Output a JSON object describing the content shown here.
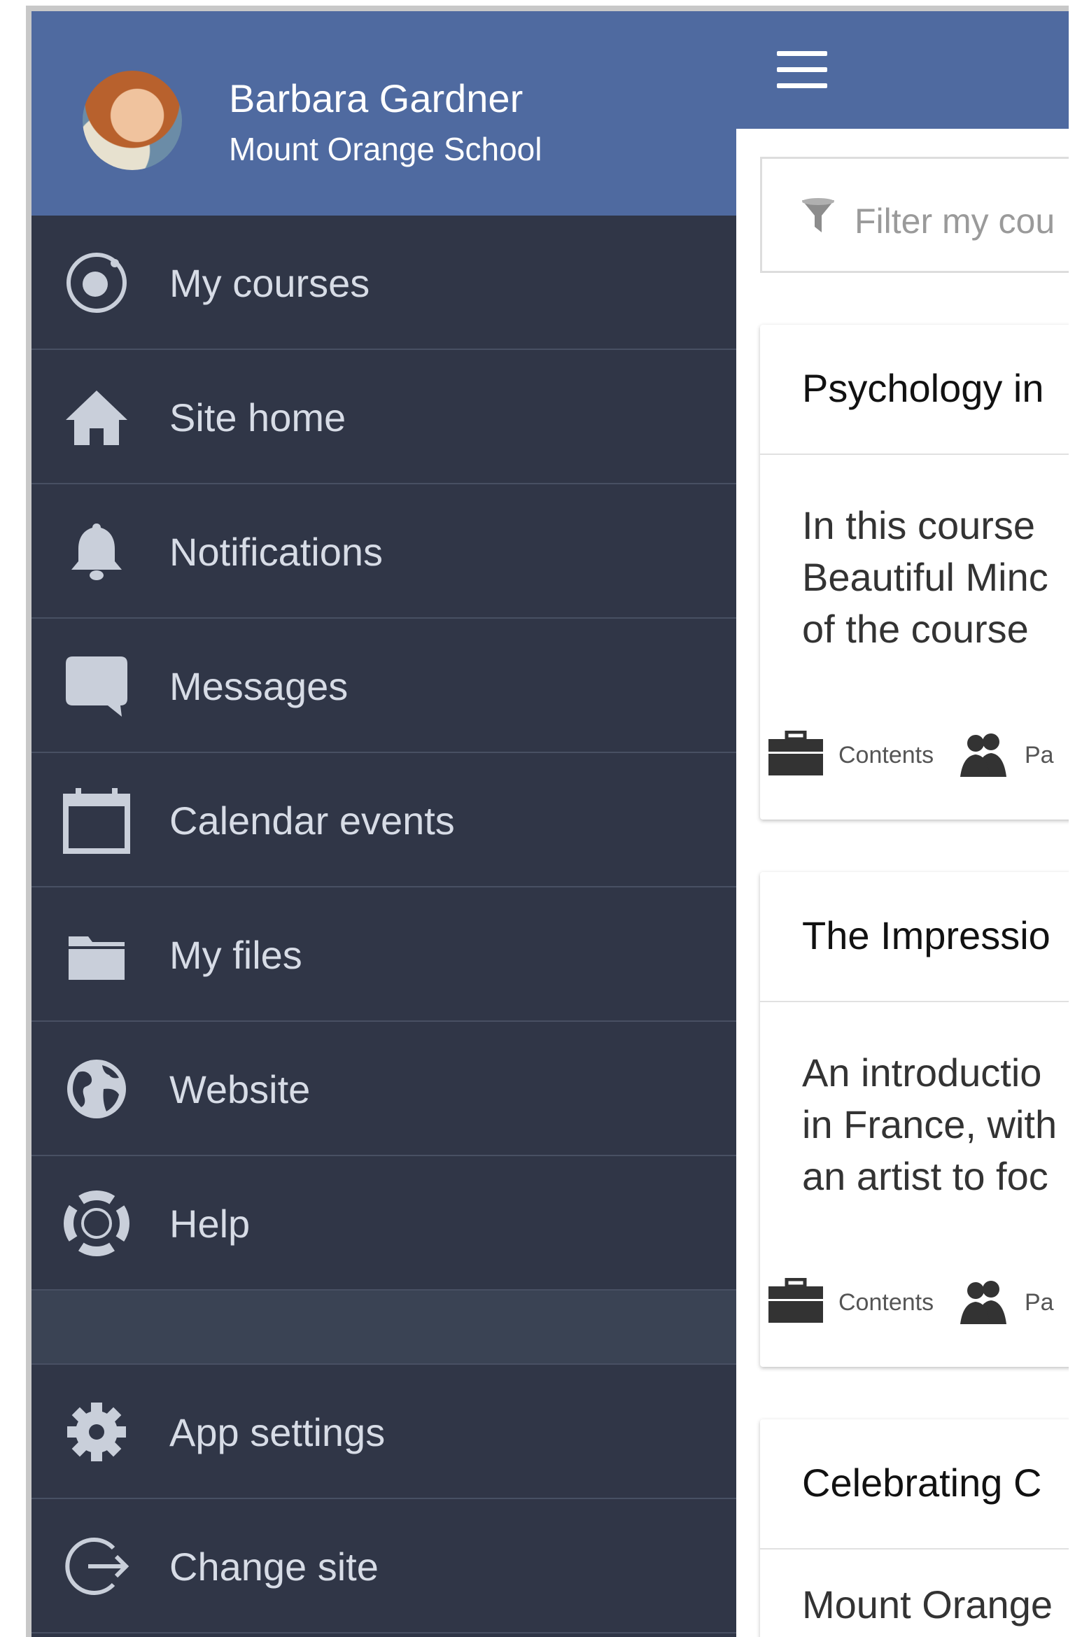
{
  "profile": {
    "name": "Barbara Gardner",
    "site": "Mount Orange School"
  },
  "menu": {
    "items": [
      {
        "label": "My courses",
        "icon": "my-courses-icon"
      },
      {
        "label": "Site home",
        "icon": "home-icon"
      },
      {
        "label": "Notifications",
        "icon": "bell-icon"
      },
      {
        "label": "Messages",
        "icon": "message-icon"
      },
      {
        "label": "Calendar events",
        "icon": "calendar-icon"
      },
      {
        "label": "My files",
        "icon": "folder-icon"
      },
      {
        "label": "Website",
        "icon": "globe-icon"
      },
      {
        "label": "Help",
        "icon": "lifebuoy-icon"
      }
    ],
    "bottom_items": [
      {
        "label": "App settings",
        "icon": "gear-icon"
      },
      {
        "label": "Change site",
        "icon": "logout-icon"
      }
    ]
  },
  "main": {
    "filter_placeholder": "Filter my cou",
    "courses": [
      {
        "title": "Psychology in",
        "summary": [
          "In this course",
          "Beautiful Minc",
          "of the course"
        ],
        "contents_label": "Contents",
        "participants_label": "Pa"
      },
      {
        "title": "The Impressio",
        "summary": [
          "An introductio",
          "in France, with",
          "an artist to foc"
        ],
        "contents_label": "Contents",
        "participants_label": "Pa"
      },
      {
        "title": "Celebrating C",
        "summary": [
          "Mount Orange"
        ]
      }
    ]
  },
  "colors": {
    "header_blue": "#4f6aa0",
    "menu_dark": "#303647",
    "menu_text": "#d7dce6"
  }
}
